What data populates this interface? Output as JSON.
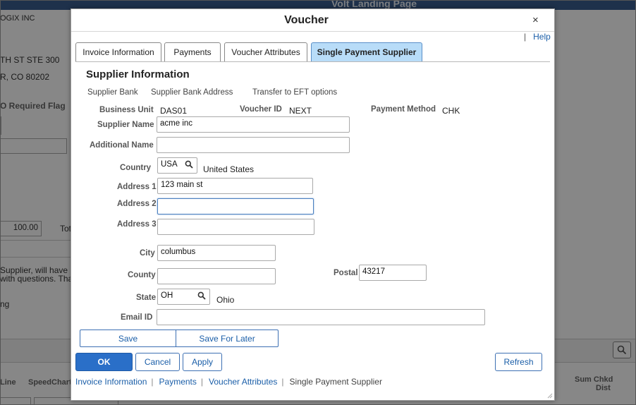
{
  "background": {
    "page_title": "Volt Landing Page",
    "company_fragment": "OGIX INC",
    "address_line": "TH ST STE 300",
    "city_line": "R, CO  80202",
    "po_flag_label": "O Required Flag",
    "amount_value": "100.00",
    "total_fragment": "Tot",
    "notice_line1": "Supplier, will have Su",
    "notice_line2": "with questions. Than",
    "misc_fragment": "ng",
    "grid_col_line": "Line",
    "grid_col_speedchart": "SpeedChart",
    "grid_col_sum_chkd_1": "Sum Chkd",
    "grid_col_sum_chkd_2": "Dist"
  },
  "modal": {
    "title": "Voucher",
    "close_glyph": "×",
    "help_sep": "|",
    "help_label": "Help",
    "tabs": [
      {
        "label": "Invoice Information",
        "active": false
      },
      {
        "label": "Payments",
        "active": false
      },
      {
        "label": "Voucher Attributes",
        "active": false
      },
      {
        "label": "Single Payment Supplier",
        "active": true
      }
    ],
    "section_title": "Supplier Information",
    "sub_links": [
      "Supplier Bank",
      "Supplier Bank Address",
      "Transfer to EFT options"
    ],
    "fields": {
      "business_unit_label": "Business Unit",
      "business_unit_value": "DAS01",
      "voucher_id_label": "Voucher ID",
      "voucher_id_value": "NEXT",
      "payment_method_label": "Payment Method",
      "payment_method_value": "CHK",
      "supplier_name_label": "Supplier Name",
      "supplier_name_value": "acme inc",
      "additional_name_label": "Additional Name",
      "additional_name_value": "",
      "country_label": "Country",
      "country_value": "USA",
      "country_desc": "United States",
      "address1_label": "Address 1",
      "address1_value": "123 main st",
      "address2_label": "Address 2",
      "address2_value": "",
      "address3_label": "Address 3",
      "address3_value": "",
      "city_label": "City",
      "city_value": "columbus",
      "county_label": "County",
      "county_value": "",
      "postal_label": "Postal",
      "postal_value": "43217",
      "state_label": "State",
      "state_value": "OH",
      "state_desc": "Ohio",
      "email_label": "Email ID",
      "email_value": ""
    },
    "save_label": "Save",
    "save_later_label": "Save For Later",
    "ok_label": "OK",
    "cancel_label": "Cancel",
    "apply_label": "Apply",
    "refresh_label": "Refresh",
    "bottom_links": [
      "Invoice Information",
      "Payments",
      "Voucher Attributes"
    ],
    "bottom_current": "Single Payment Supplier",
    "bottom_sep": "|"
  },
  "colors": {
    "active_tab": "#b8dcf8",
    "primary_button": "#2a6fc8",
    "link": "#1a5ea8"
  }
}
